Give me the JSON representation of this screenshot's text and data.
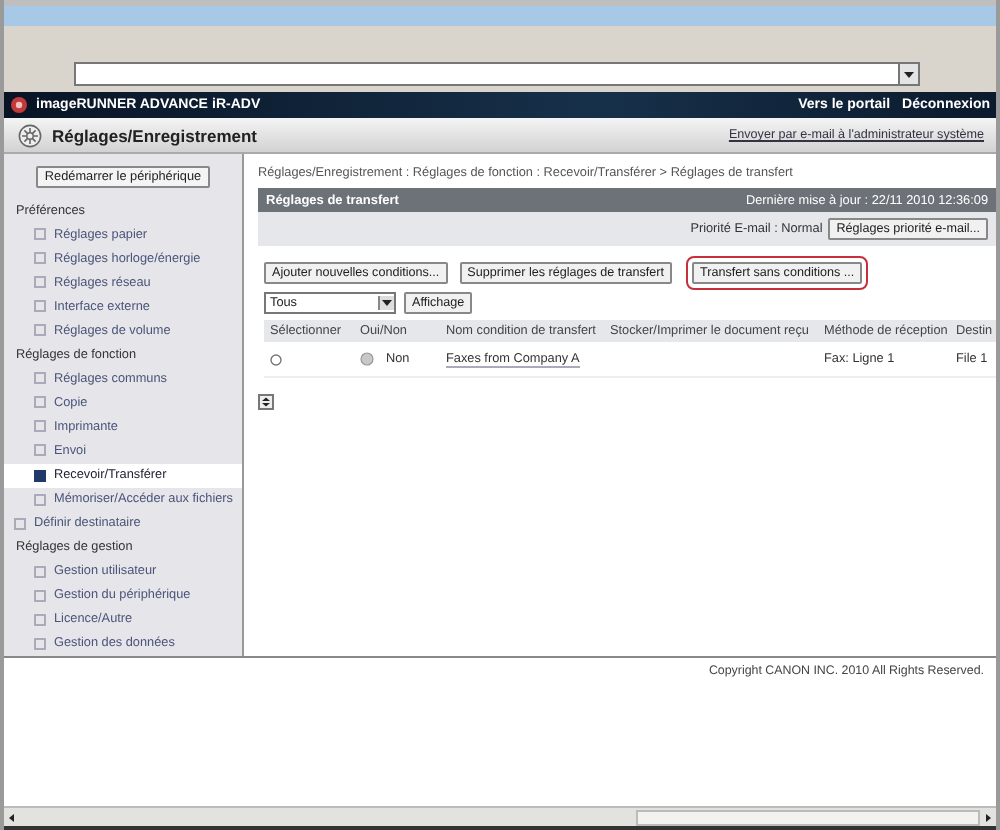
{
  "header": {
    "brand": "imageRUNNER ADVANCE",
    "model": "iR-ADV",
    "links": [
      "Vers le portail",
      "Déconnexion"
    ]
  },
  "title_bar": {
    "title": "Réglages/Enregistrement",
    "link": "Envoyer par e-mail à l'administrateur système"
  },
  "sidebar": {
    "restart_button": "Redémarrer le périphérique",
    "items": [
      {
        "label": "Préférences",
        "kind": "heading",
        "children": [
          {
            "label": "Réglages papier",
            "selected": false
          },
          {
            "label": "Réglages horloge/énergie",
            "selected": false
          },
          {
            "label": "Réglages réseau",
            "selected": false
          },
          {
            "label": "Interface externe",
            "selected": false
          },
          {
            "label": "Réglages de volume",
            "selected": false
          }
        ]
      },
      {
        "label": "Réglages de fonction",
        "kind": "heading",
        "children": [
          {
            "label": "Réglages communs",
            "selected": false
          },
          {
            "label": "Copie",
            "selected": false
          },
          {
            "label": "Imprimante",
            "selected": false
          },
          {
            "label": "Envoi",
            "selected": false
          },
          {
            "label": "Recevoir/Transférer",
            "selected": true
          },
          {
            "label": "Mémoriser/Accéder aux fichiers",
            "selected": false
          }
        ]
      },
      {
        "label": "Définir destinataire",
        "kind": "link",
        "selected": false
      },
      {
        "label": "Réglages de gestion",
        "kind": "heading",
        "children": [
          {
            "label": "Gestion utilisateur",
            "selected": false
          },
          {
            "label": "Gestion du périphérique",
            "selected": false
          },
          {
            "label": "Licence/Autre",
            "selected": false
          },
          {
            "label": "Gestion des données",
            "selected": false
          }
        ]
      }
    ]
  },
  "breadcrumb": "Réglages/Enregistrement : Réglages de fonction : Recevoir/Transférer > Réglages de transfert",
  "panel": {
    "title": "Réglages de transfert",
    "last_update": "Dernière mise à jour : 22/11 2010 12:36:09",
    "priority": "Priorité E-mail : Normal",
    "priority_button": "Réglages priorité e-mail...",
    "actions": [
      {
        "label": "Ajouter nouvelles conditions...",
        "highlighted": false
      },
      {
        "label": "Supprimer les réglages de transfert",
        "highlighted": false
      },
      {
        "label": "Transfert sans conditions ...",
        "highlighted": true
      }
    ],
    "filter": {
      "value": "Tous",
      "button": "Affichage"
    },
    "table": {
      "columns": [
        "Sélectionner",
        "Oui/Non",
        "Nom condition de transfert",
        "Stocker/Imprimer le document reçu",
        "Méthode de réception",
        "Destin"
      ],
      "rows": [
        {
          "selected": false,
          "on": false,
          "on_label": "Non",
          "name": "Faxes from Company A",
          "method": "Fax: Ligne 1",
          "destination": "File 1"
        }
      ]
    }
  },
  "footer": "Copyright CANON INC. 2010 All Rights Reserved."
}
